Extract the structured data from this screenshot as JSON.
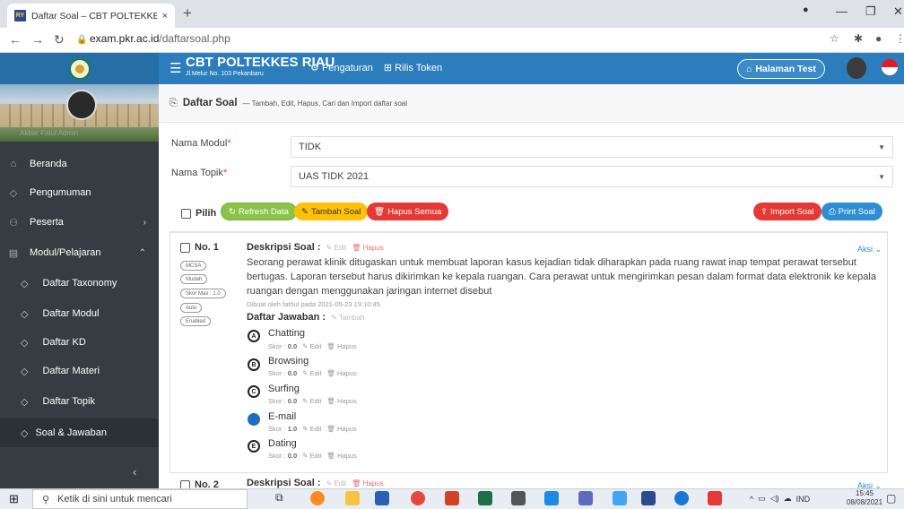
{
  "browser": {
    "tab_title": "Daftar Soal – CBT POLTEKKES RIA",
    "tab_close": "×",
    "new_tab": "+",
    "url_host": "exam.pkr.ac.id",
    "url_path": "/daftarsoal.php",
    "favicon_text": "RY"
  },
  "header": {
    "brand_title": "CBT POLTEKKES RIAU",
    "brand_subtitle": "Jl.Melur No. 103 Pekanbaru",
    "menu": [
      {
        "icon": "gears-icon",
        "label": "Pengaturan"
      },
      {
        "icon": "grid-icon",
        "label": "Rilis Token"
      }
    ],
    "halaman_test": "Halaman Test"
  },
  "sidebar": {
    "profile_name": "Akbar Fatul  Admin",
    "items": [
      {
        "label": "Beranda",
        "icon": "home-icon"
      },
      {
        "label": "Pengumuman",
        "icon": "tag-icon"
      },
      {
        "label": "Peserta",
        "icon": "users-icon",
        "arrow": "›"
      },
      {
        "label": "Modul/Pelajaran",
        "icon": "book-icon",
        "arrow": "⌃"
      }
    ],
    "subitems": [
      {
        "label": "Daftar Taxonomy"
      },
      {
        "label": "Daftar Modul"
      },
      {
        "label": "Daftar KD"
      },
      {
        "label": "Daftar Materi"
      },
      {
        "label": "Daftar Topik"
      },
      {
        "label": "Soal & Jawaban",
        "active": true
      }
    ],
    "collapse": "‹"
  },
  "page": {
    "title": "Daftar Soal",
    "subtitle": "— Tambah, Edit, Hapus, Cari dan Import daftar soal",
    "modul_label": "Nama Modul",
    "modul_value": "TIDK",
    "topik_label": "Nama Topik",
    "topik_value": "UAS TIDK 2021",
    "required_mark": "*"
  },
  "toolbar": {
    "pilih": "Pilih",
    "refresh": "Refresh Data",
    "tambah": "Tambah Soal",
    "hapus_semua": "Hapus Semua",
    "import": "Import Soal",
    "print": "Print Soal"
  },
  "question1": {
    "number": "No. 1",
    "badges": [
      "MCSA",
      "Mudah",
      "Skor Max : 1.0",
      "Auto",
      "Enabled"
    ],
    "desc_label": "Deskripsi Soal :",
    "edit": "Edit",
    "hapus": "Hapus",
    "aksi": "Aksi",
    "text": "Seorang perawat klinik ditugaskan untuk membuat laporan kasus kejadian tidak diharapkan pada ruang rawat inap tempat perawat tersebut bertugas. Laporan tersebut harus dikirimkan ke kepala ruangan. Cara perawat untuk mengirimkan pesan dalam format data elektronik ke kepala ruangan dengan menggunakan jaringan internet disebut",
    "creator": "Dibuat oleh fathul pada 2021-05-23 19:10:45",
    "answers_label": "Daftar Jawaban :",
    "answers_add": "Tambah",
    "answers": [
      {
        "letter": "A",
        "text": "Chatting",
        "score": "0.0",
        "correct": false
      },
      {
        "letter": "B",
        "text": "Browsing",
        "score": "0.0",
        "correct": false
      },
      {
        "letter": "C",
        "text": "Surfing",
        "score": "0.0",
        "correct": false
      },
      {
        "letter": "D",
        "text": "E-mail",
        "score": "1.0",
        "correct": true
      },
      {
        "letter": "E",
        "text": "Dating",
        "score": "0.0",
        "correct": false
      }
    ],
    "score_label": "Skor :",
    "edit_small": "Edit",
    "hapus_small": "Hapus"
  },
  "question2": {
    "number": "No. 2",
    "desc_label": "Deskripsi Soal :",
    "edit": "Edit",
    "hapus": "Hapus",
    "aksi": "Aksi"
  },
  "taskbar": {
    "search_placeholder": "Ketik di sini untuk mencari",
    "lang": "IND",
    "time": "15:45",
    "date": "08/08/2021"
  }
}
